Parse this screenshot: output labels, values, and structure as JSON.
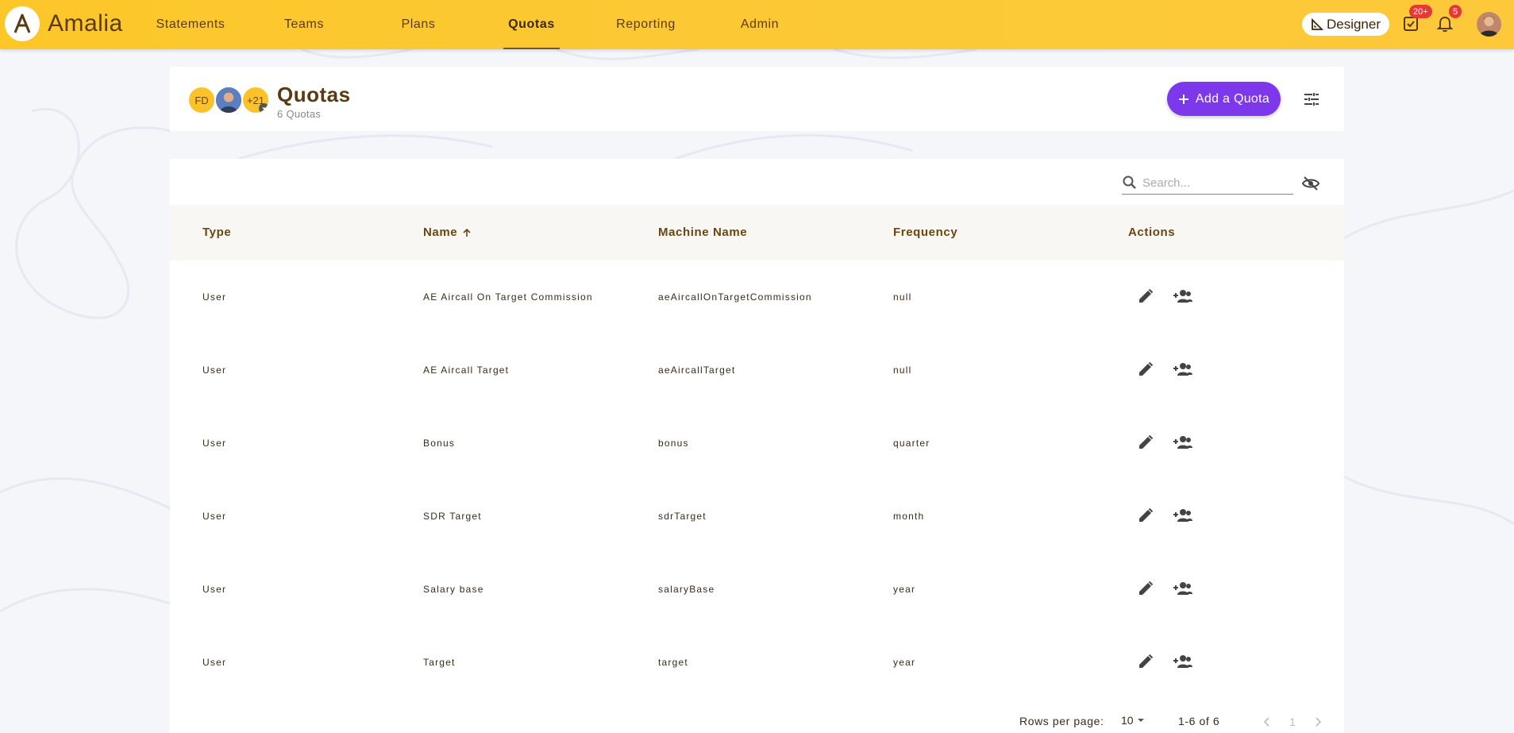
{
  "app": {
    "name": "Amalia",
    "logo_letter": "A"
  },
  "nav": {
    "items": [
      {
        "label": "Statements",
        "active": false
      },
      {
        "label": "Teams",
        "active": false
      },
      {
        "label": "Plans",
        "active": false
      },
      {
        "label": "Quotas",
        "active": true
      },
      {
        "label": "Reporting",
        "active": false
      },
      {
        "label": "Admin",
        "active": false
      }
    ]
  },
  "topbar": {
    "designer_label": "Designer",
    "todo_badge": "20+",
    "notifications_badge": "5"
  },
  "page": {
    "title": "Quotas",
    "subtitle": "6 Quotas",
    "add_button_label": "Add a Quota",
    "avatars": {
      "initials": "FD",
      "extra_count": "+21"
    }
  },
  "search": {
    "placeholder": "Search..."
  },
  "table": {
    "columns": {
      "type": "Type",
      "name": "Name",
      "machine_name": "Machine Name",
      "frequency": "Frequency",
      "actions": "Actions"
    },
    "rows": [
      {
        "type": "User",
        "name": "AE Aircall On Target Commission",
        "machine_name": "aeAircallOnTargetCommission",
        "frequency": "null"
      },
      {
        "type": "User",
        "name": "AE Aircall Target",
        "machine_name": "aeAircallTarget",
        "frequency": "null"
      },
      {
        "type": "User",
        "name": "Bonus",
        "machine_name": "bonus",
        "frequency": "quarter"
      },
      {
        "type": "User",
        "name": "SDR Target",
        "machine_name": "sdrTarget",
        "frequency": "month"
      },
      {
        "type": "User",
        "name": "Salary base",
        "machine_name": "salaryBase",
        "frequency": "year"
      },
      {
        "type": "User",
        "name": "Target",
        "machine_name": "target",
        "frequency": "year"
      }
    ]
  },
  "pagination": {
    "rows_per_page_label": "Rows per page:",
    "rows_per_page_value": "10",
    "range": "1-6 of 6",
    "current_page": "1"
  },
  "colors": {
    "topbar": "#fdc72a",
    "accent": "#7d38ec",
    "text": "#5a3a10",
    "badge": "#e53935"
  }
}
